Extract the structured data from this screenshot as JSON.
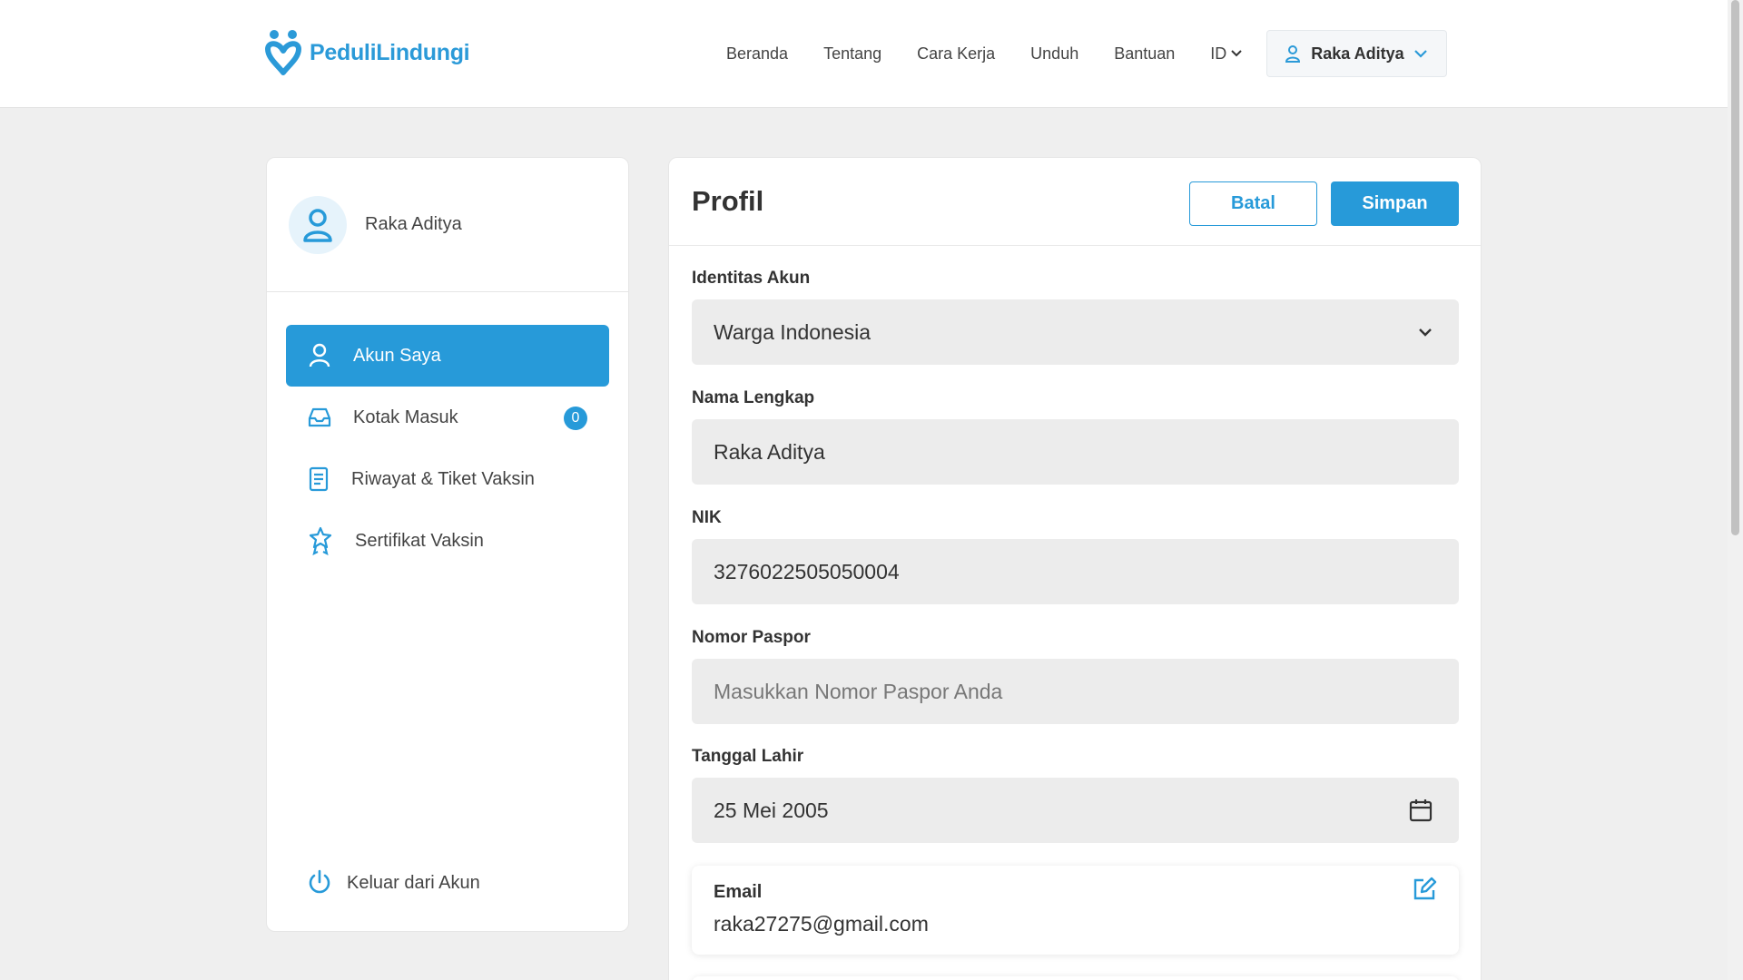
{
  "brand": {
    "name": "PeduliLindungi",
    "color": "#2b9ad8"
  },
  "header": {
    "nav": [
      "Beranda",
      "Tentang",
      "Cara Kerja",
      "Unduh",
      "Bantuan"
    ],
    "language": "ID",
    "user_name": "Raka Aditya"
  },
  "sidebar": {
    "profile_name": "Raka Aditya",
    "items": [
      {
        "label": "Akun Saya",
        "icon": "user-icon",
        "active": true
      },
      {
        "label": "Kotak Masuk",
        "icon": "inbox-icon",
        "badge": "0"
      },
      {
        "label": "Riwayat & Tiket Vaksin",
        "icon": "document-icon"
      },
      {
        "label": "Sertifikat Vaksin",
        "icon": "award-icon"
      }
    ],
    "logout_label": "Keluar dari Akun"
  },
  "main": {
    "title": "Profil",
    "cancel_label": "Batal",
    "save_label": "Simpan",
    "fields": {
      "identity": {
        "label": "Identitas Akun",
        "value": "Warga Indonesia"
      },
      "full_name": {
        "label": "Nama Lengkap",
        "value": "Raka Aditya"
      },
      "nik": {
        "label": "NIK",
        "value": "3276022505050004"
      },
      "passport": {
        "label": "Nomor Paspor",
        "placeholder": "Masukkan Nomor Paspor Anda"
      },
      "birth_date": {
        "label": "Tanggal Lahir",
        "value": "25 Mei 2005"
      },
      "email": {
        "label": "Email",
        "value": "raka27275@gmail.com"
      }
    }
  },
  "colors": {
    "accent": "#279ad9",
    "page_bg": "#efefef",
    "field_bg": "#ececec"
  }
}
